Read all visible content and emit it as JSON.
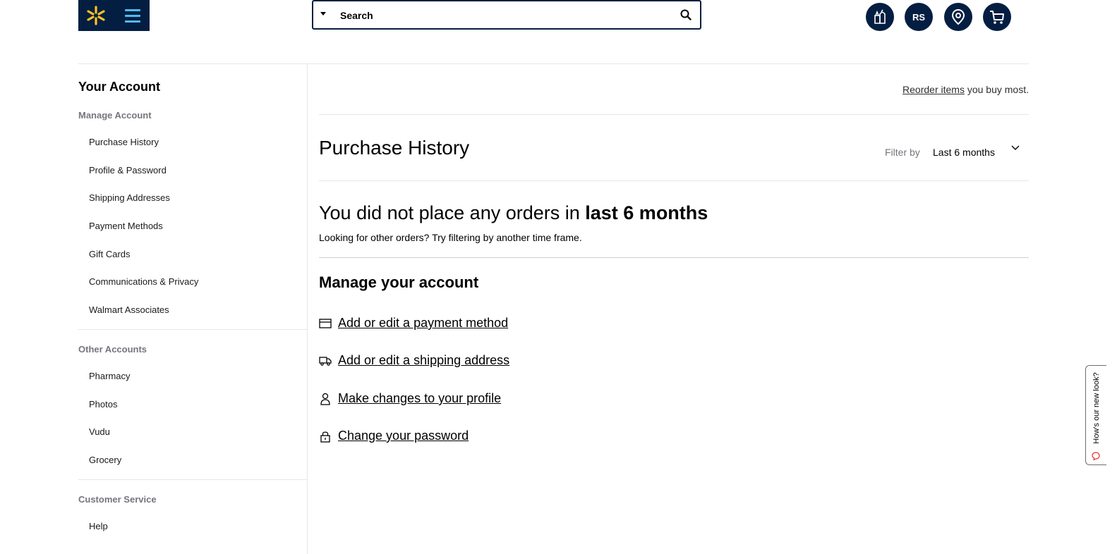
{
  "header": {
    "search_placeholder": "Search",
    "icons": [
      "spark-logo-icon",
      "menu-icon",
      "reorder-icon",
      "account-icon",
      "location-icon",
      "cart-icon"
    ],
    "account_initials": "RS",
    "colors": {
      "navy": "#041e42",
      "spark": "#ffc220",
      "menu_blue": "#4dbdf5"
    }
  },
  "sidebar": {
    "title": "Your Account",
    "sections": [
      {
        "heading": "Manage Account",
        "items": [
          "Purchase History",
          "Profile & Password",
          "Shipping Addresses",
          "Payment Methods",
          "Gift Cards",
          "Communications & Privacy",
          "Walmart Associates"
        ]
      },
      {
        "heading": "Other Accounts",
        "items": [
          "Pharmacy",
          "Photos",
          "Vudu",
          "Grocery"
        ]
      },
      {
        "heading": "Customer Service",
        "items": [
          "Help"
        ]
      }
    ]
  },
  "main": {
    "reorder_link": "Reorder items",
    "reorder_suffix": " you buy most.",
    "page_title": "Purchase History",
    "filter_label": "Filter by",
    "filter_value": "Last 6 months",
    "empty_prefix": "You did not place any orders in ",
    "empty_bold": "last 6 months",
    "empty_sub": "Looking for other orders? Try filtering by another time frame.",
    "manage_title": "Manage your account",
    "links": [
      {
        "label": "Add or edit a payment method",
        "icon": "credit-card-icon"
      },
      {
        "label": "Add or edit a shipping address",
        "icon": "truck-icon"
      },
      {
        "label": "Make changes to your profile",
        "icon": "person-icon"
      },
      {
        "label": "Change your password",
        "icon": "lock-icon"
      }
    ]
  },
  "feedback": {
    "label": "How's our new look?"
  }
}
